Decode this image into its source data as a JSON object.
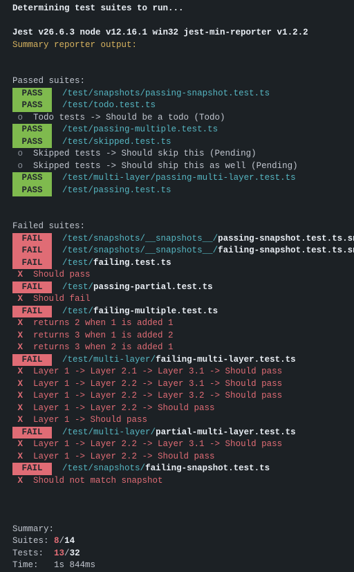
{
  "header": {
    "determining": "Determining test suites to run...",
    "env": "Jest v26.6.3 node v12.16.1 win32 jest-min-reporter v1.2.2",
    "summary_reporter": "Summary reporter output:"
  },
  "passed_header": "Passed suites:",
  "badges": {
    "pass": "PASS",
    "fail": "FAIL"
  },
  "bullets": {
    "todo": "o",
    "fail": "X"
  },
  "passed": [
    {
      "path": "/test/snapshots/passing-snapshot.test.ts"
    },
    {
      "path": "/test/todo.test.ts"
    },
    {
      "sub": "Todo tests -> Should be a todo (Todo)"
    },
    {
      "path": "/test/passing-multiple.test.ts"
    },
    {
      "path": "/test/skipped.test.ts"
    },
    {
      "sub": "Skipped tests -> Should skip this (Pending)"
    },
    {
      "sub": "Skipped tests -> Should ship this as well (Pending)"
    },
    {
      "path": "/test/multi-layer/passing-multi-layer.test.ts"
    },
    {
      "path": "/test/passing.test.ts"
    }
  ],
  "failed_header": "Failed suites:",
  "failed": [
    {
      "dir": "/test/snapshots/__snapshots__/",
      "file": "passing-snapshot.test.ts.snap"
    },
    {
      "dir": "/test/snapshots/__snapshots__/",
      "file": "failing-snapshot.test.ts.snap"
    },
    {
      "dir": "/test/",
      "file": "failing.test.ts"
    },
    {
      "x": "Should pass"
    },
    {
      "dir": "/test/",
      "file": "passing-partial.test.ts"
    },
    {
      "x": "Should fail"
    },
    {
      "dir": "/test/",
      "file": "failing-multiple.test.ts"
    },
    {
      "x": "returns 2 when 1 is added 1"
    },
    {
      "x": "returns 3 when 1 is added 2"
    },
    {
      "x": "returns 3 when 2 is added 1"
    },
    {
      "dir": "/test/multi-layer/",
      "file": "failing-multi-layer.test.ts"
    },
    {
      "x": "Layer 1 -> Layer 2.1 -> Layer 3.1 -> Should pass"
    },
    {
      "x": "Layer 1 -> Layer 2.2 -> Layer 3.1 -> Should pass"
    },
    {
      "x": "Layer 1 -> Layer 2.2 -> Layer 3.2 -> Should pass"
    },
    {
      "x": "Layer 1 -> Layer 2.2 -> Should pass"
    },
    {
      "x": "Layer 1 -> Should pass"
    },
    {
      "dir": "/test/multi-layer/",
      "file": "partial-multi-layer.test.ts"
    },
    {
      "x": "Layer 1 -> Layer 2.2 -> Layer 3.1 -> Should pass"
    },
    {
      "x": "Layer 1 -> Layer 2.2 -> Should pass"
    },
    {
      "dir": "/test/snapshots/",
      "file": "failing-snapshot.test.ts"
    },
    {
      "x": "Should not match snapshot"
    }
  ],
  "summary": {
    "header": "Summary:",
    "suites_label": "Suites:",
    "suites_fail": "8",
    "slash1": "/",
    "suites_total": "14",
    "tests_label": "Tests:",
    "tests_fail": "13",
    "slash2": "/",
    "tests_total": "32",
    "time_label": "Time:",
    "time_value": "1s 844ms"
  }
}
